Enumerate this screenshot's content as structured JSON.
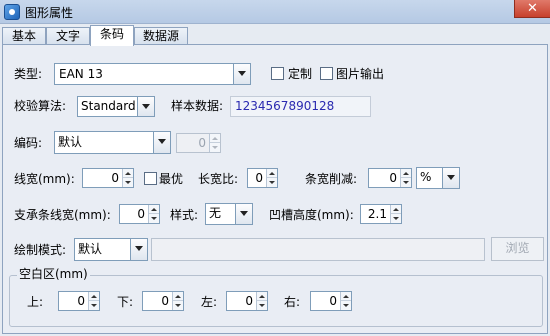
{
  "window": {
    "title": "图形属性",
    "close_glyph": "✕"
  },
  "tabs": [
    {
      "label": "基本",
      "active": false
    },
    {
      "label": "文字",
      "active": false
    },
    {
      "label": "条码",
      "active": true
    },
    {
      "label": "数据源",
      "active": false
    }
  ],
  "barcode": {
    "type_label": "类型:",
    "type_value": "EAN 13",
    "custom_label": "定制",
    "custom_checked": false,
    "image_output_label": "图片输出",
    "image_output_checked": false,
    "checksum_label": "校验算法:",
    "checksum_value": "Standard",
    "sample_label": "样本数据:",
    "sample_value": "1234567890128",
    "encoding_label": "编码:",
    "encoding_value": "默认",
    "encoding_extra_value": "0",
    "line_width_label": "线宽(mm):",
    "line_width_value": "0",
    "optimal_label": "最优",
    "optimal_checked": false,
    "aspect_label": "长宽比:",
    "aspect_value": "0",
    "bar_reduction_label": "条宽削减:",
    "bar_reduction_value": "0",
    "bar_reduction_unit": "%",
    "support_bar_label": "支承条线宽(mm):",
    "support_bar_value": "0",
    "style_label": "样式:",
    "style_value": "无",
    "notch_label": "凹槽高度(mm):",
    "notch_value": "2.1",
    "draw_mode_label": "绘制模式:",
    "draw_mode_value": "默认",
    "browse_label": "浏览"
  },
  "quiet_zone": {
    "title": "空白区(mm)",
    "top_label": "上:",
    "top_value": "0",
    "bottom_label": "下:",
    "bottom_value": "0",
    "left_label": "左:",
    "left_value": "0",
    "right_label": "右:",
    "right_value": "0"
  }
}
